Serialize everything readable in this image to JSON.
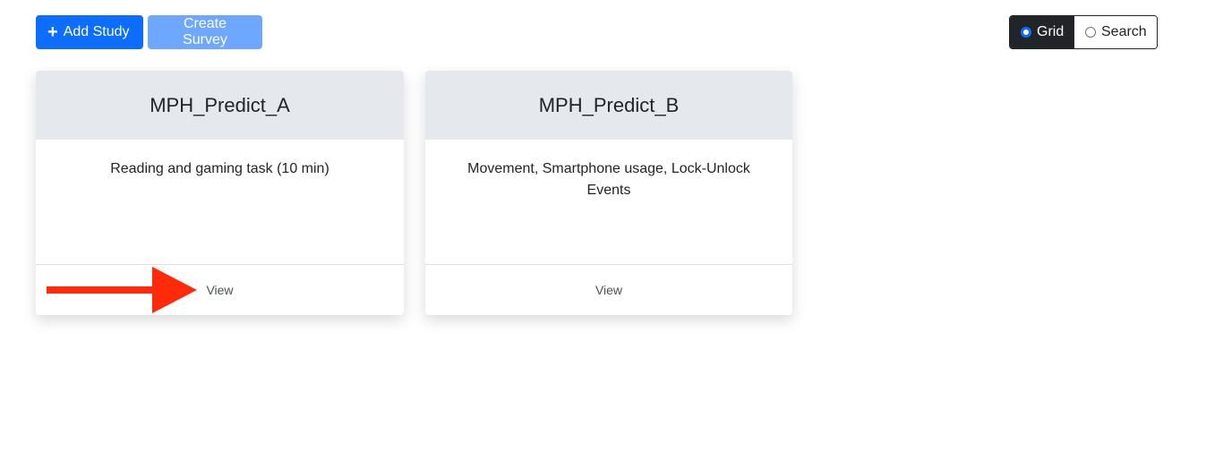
{
  "toolbar": {
    "add_study_label": "Add Study",
    "add_study_icon": "plus-icon",
    "create_survey_label": "Create Survey"
  },
  "view_toggle": {
    "options": [
      {
        "label": "Grid",
        "selected": true
      },
      {
        "label": "Search",
        "selected": false
      }
    ]
  },
  "studies": [
    {
      "title": "MPH_Predict_A",
      "description": "Reading and gaming task (10 min)",
      "action": "View"
    },
    {
      "title": "MPH_Predict_B",
      "description": "Movement, Smartphone usage, Lock-Unlock Events",
      "action": "View"
    }
  ],
  "annotation": {
    "arrow_color": "#ff2a0a",
    "points_to": "View"
  },
  "colors": {
    "primary": "#0d6efd",
    "primary_disabled": "#6ea8fe",
    "dark": "#212529",
    "card_header": "#e5e8ec"
  }
}
